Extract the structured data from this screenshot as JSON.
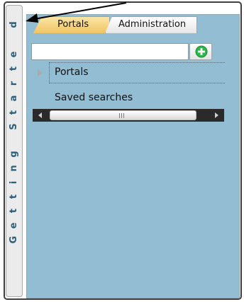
{
  "rail": {
    "letters": [
      "d",
      "e",
      "t",
      "r",
      "a",
      "t",
      "S",
      "",
      "g",
      "n",
      "i",
      "t",
      "t",
      "e",
      "G"
    ]
  },
  "tabs": {
    "portals": "Portals",
    "administration": "Administration"
  },
  "search": {
    "value": "",
    "placeholder": ""
  },
  "tree": {
    "portals": "Portals",
    "saved_searches": "Saved searches"
  },
  "colors": {
    "panel_bg": "#93bdd2",
    "tab_active": "#f0c463",
    "add_icon": "#2db84a"
  },
  "icons": {
    "add": "plus-circle-icon",
    "expander": "triangle-right-icon",
    "scroll_left": "scroll-left-arrow-icon",
    "scroll_right": "scroll-right-arrow-icon",
    "pointer": "arrow-pointer-icon"
  }
}
